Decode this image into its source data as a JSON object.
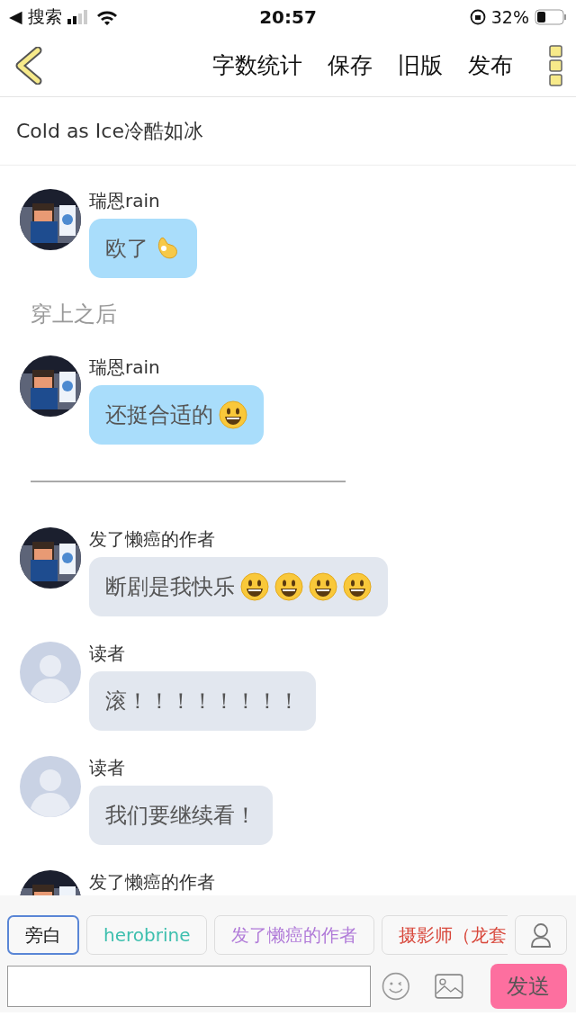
{
  "status_bar": {
    "back_label": "◀ 搜索",
    "time": "20:57",
    "battery": "32%"
  },
  "toolbar": {
    "actions": [
      "字数统计",
      "保存",
      "旧版",
      "发布"
    ]
  },
  "title": "Cold as Ice冷酷如冰",
  "messages": [
    {
      "kind": "message",
      "author": "瑞恩rain",
      "text": "欧了",
      "emojis": [
        {
          "kind": "ok"
        }
      ],
      "color": "#a9ddfb"
    },
    {
      "kind": "narration",
      "text": "穿上之后"
    },
    {
      "kind": "message",
      "author": "瑞恩rain",
      "text": "还挺合适的",
      "emojis": [
        {
          "kind": "smile"
        }
      ],
      "color": "#a9ddfb"
    },
    {
      "kind": "divider"
    },
    {
      "kind": "message",
      "author": "发了懒癌的作者",
      "text": "断剧是我快乐",
      "emojis": [
        {
          "kind": "smile"
        },
        {
          "kind": "smile"
        },
        {
          "kind": "smile"
        },
        {
          "kind": "smile"
        }
      ],
      "color": "#e2e7ef"
    },
    {
      "kind": "message",
      "author": "读者",
      "avatar": {
        "kind": "default"
      },
      "text": "滚！！！！！！！！",
      "color": "#e2e7ef"
    },
    {
      "kind": "message",
      "author": "读者",
      "avatar": {
        "kind": "default"
      },
      "text": "我们要继续看！",
      "color": "#e2e7ef"
    },
    {
      "kind": "message",
      "author": "发了懒癌的作者"
    }
  ],
  "roles": [
    {
      "label": "旁白",
      "color": "#222222",
      "selected": true
    },
    {
      "label": "herobrine",
      "color": "#3dbfae",
      "selected": false
    },
    {
      "label": "发了懒癌的作者",
      "color": "#b07ad8",
      "selected": false
    },
    {
      "label": "摄影师（龙套",
      "color": "#d8483c",
      "selected": false
    }
  ],
  "composer": {
    "send": "发送"
  }
}
